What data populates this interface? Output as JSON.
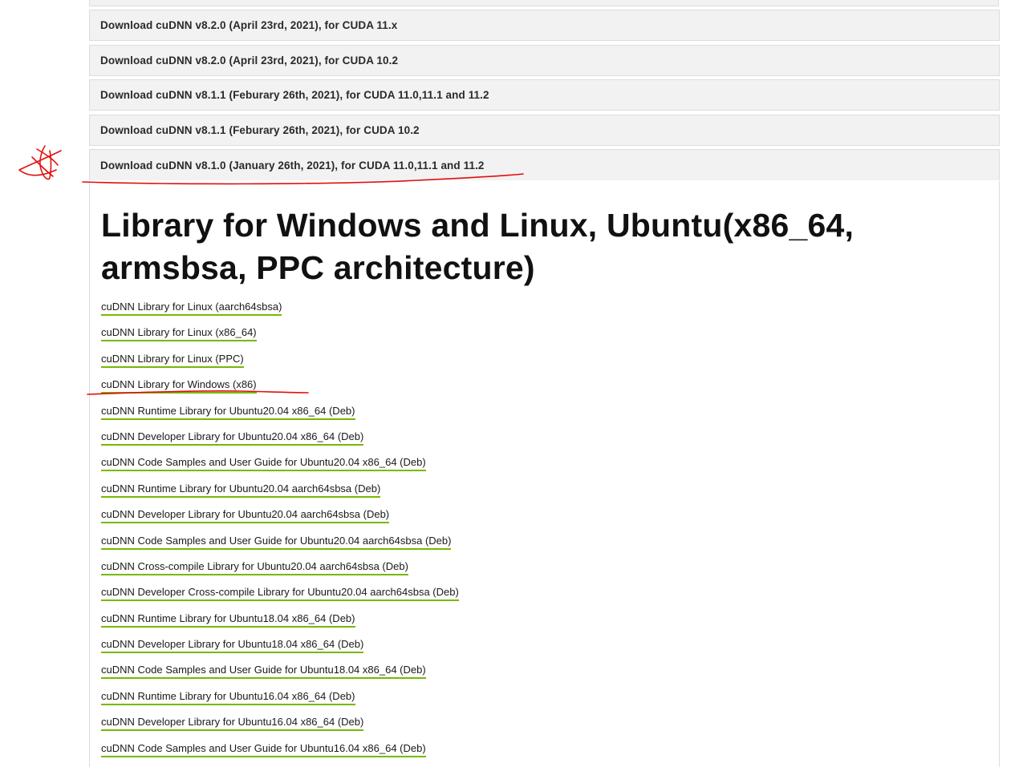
{
  "accordion": {
    "items": [
      {
        "label": "Download cuDNN v8.2.0 (April 23rd, 2021), for CUDA 11.x"
      },
      {
        "label": "Download cuDNN v8.2.0 (April 23rd, 2021), for CUDA 10.2"
      },
      {
        "label": "Download cuDNN v8.1.1 (Feburary 26th, 2021), for CUDA 11.0,11.1 and 11.2"
      },
      {
        "label": "Download cuDNN v8.1.1 (Feburary 26th, 2021), for CUDA 10.2"
      },
      {
        "label": "Download cuDNN v8.1.0 (January 26th, 2021), for CUDA 11.0,11.1 and 11.2"
      }
    ]
  },
  "panel": {
    "title": "Library for Windows and Linux, Ubuntu(x86_64, armsbsa, PPC architecture)",
    "links": [
      {
        "label": "cuDNN Library for Linux (aarch64sbsa)"
      },
      {
        "label": "cuDNN Library for Linux (x86_64)"
      },
      {
        "label": "cuDNN Library for Linux (PPC)"
      },
      {
        "label": "cuDNN Library for Windows (x86)"
      },
      {
        "label": "cuDNN Runtime Library for Ubuntu20.04 x86_64 (Deb)"
      },
      {
        "label": "cuDNN Developer Library for Ubuntu20.04 x86_64 (Deb)"
      },
      {
        "label": "cuDNN Code Samples and User Guide for Ubuntu20.04 x86_64 (Deb)"
      },
      {
        "label": "cuDNN Runtime Library for Ubuntu20.04 aarch64sbsa (Deb)"
      },
      {
        "label": "cuDNN Developer Library for Ubuntu20.04 aarch64sbsa (Deb)"
      },
      {
        "label": "cuDNN Code Samples and User Guide for Ubuntu20.04 aarch64sbsa (Deb)"
      },
      {
        "label": "cuDNN Cross-compile Library for Ubuntu20.04 aarch64sbsa (Deb)"
      },
      {
        "label": "cuDNN Developer Cross-compile Library for Ubuntu20.04 aarch64sbsa (Deb)"
      },
      {
        "label": "cuDNN Runtime Library for Ubuntu18.04 x86_64 (Deb)"
      },
      {
        "label": "cuDNN Developer Library for Ubuntu18.04 x86_64 (Deb)"
      },
      {
        "label": "cuDNN Code Samples and User Guide for Ubuntu18.04 x86_64 (Deb)"
      },
      {
        "label": "cuDNN Runtime Library for Ubuntu16.04 x86_64 (Deb)"
      },
      {
        "label": "cuDNN Developer Library for Ubuntu16.04 x86_64 (Deb)"
      },
      {
        "label": "cuDNN Code Samples and User Guide for Ubuntu16.04 x86_64 (Deb)"
      }
    ]
  },
  "colors": {
    "link_underline": "#76b900",
    "annotation_ink": "#e01010",
    "accordion_bg": "#f2f2f2"
  }
}
